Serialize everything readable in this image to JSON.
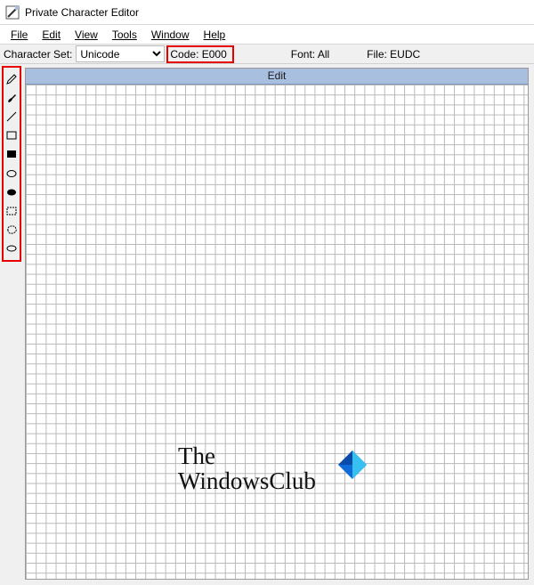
{
  "window": {
    "title": "Private Character Editor"
  },
  "menu": {
    "file": "File",
    "edit": "Edit",
    "view": "View",
    "tools": "Tools",
    "window": "Window",
    "help": "Help"
  },
  "infobar": {
    "charset_label": "Character Set:",
    "charset_value": "Unicode",
    "code_label": "Code:",
    "code_value": "E000",
    "font_label": "Font:",
    "font_value": "All",
    "file_label": "File:",
    "file_value": "EUDC"
  },
  "canvas": {
    "title": "Edit"
  },
  "tools": {
    "pencil": "pencil",
    "brush": "brush",
    "line": "line",
    "rect_outline": "rectangle-outline",
    "rect_filled": "rectangle-filled",
    "ellipse_outline": "ellipse-outline",
    "ellipse_filled": "ellipse-filled",
    "select_rect": "rectangular-select",
    "select_free": "freeform-select",
    "eraser": "eraser"
  },
  "watermark": {
    "line1": "The",
    "line2": "WindowsClub"
  },
  "colors": {
    "highlight": "#e60000",
    "canvas_header": "#a8bfe0"
  }
}
